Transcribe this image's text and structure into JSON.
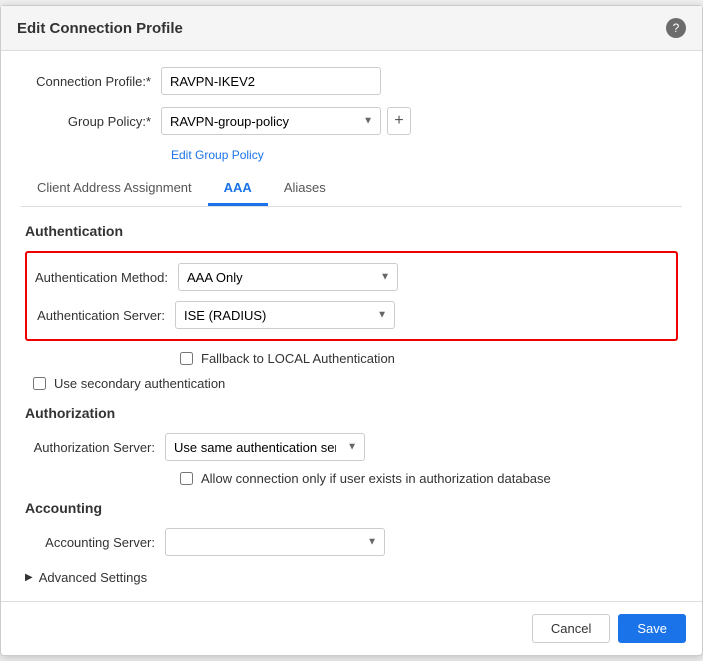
{
  "dialog": {
    "title": "Edit Connection Profile",
    "help_icon": "?"
  },
  "form": {
    "connection_profile_label": "Connection Profile:*",
    "connection_profile_value": "RAVPN-IKEV2",
    "group_policy_label": "Group Policy:*",
    "group_policy_value": "RAVPN-group-policy",
    "edit_group_policy_link": "Edit Group Policy"
  },
  "tabs": [
    {
      "id": "client-address",
      "label": "Client Address Assignment",
      "active": false
    },
    {
      "id": "aaa",
      "label": "AAA",
      "active": true
    },
    {
      "id": "aliases",
      "label": "Aliases",
      "active": false
    }
  ],
  "authentication": {
    "section_title": "Authentication",
    "method_label": "Authentication Method:",
    "method_value": "AAA Only",
    "server_label": "Authentication Server:",
    "server_value": "ISE (RADIUS)",
    "fallback_label": "Fallback to LOCAL Authentication",
    "secondary_label": "Use secondary authentication"
  },
  "authorization": {
    "section_title": "Authorization",
    "server_label": "Authorization Server:",
    "server_value": "Use same authentication server",
    "allow_label": "Allow connection only if user exists in authorization database"
  },
  "accounting": {
    "section_title": "Accounting",
    "server_label": "Accounting Server:",
    "server_value": ""
  },
  "advanced": {
    "label": "Advanced Settings"
  },
  "footer": {
    "cancel_label": "Cancel",
    "save_label": "Save"
  }
}
